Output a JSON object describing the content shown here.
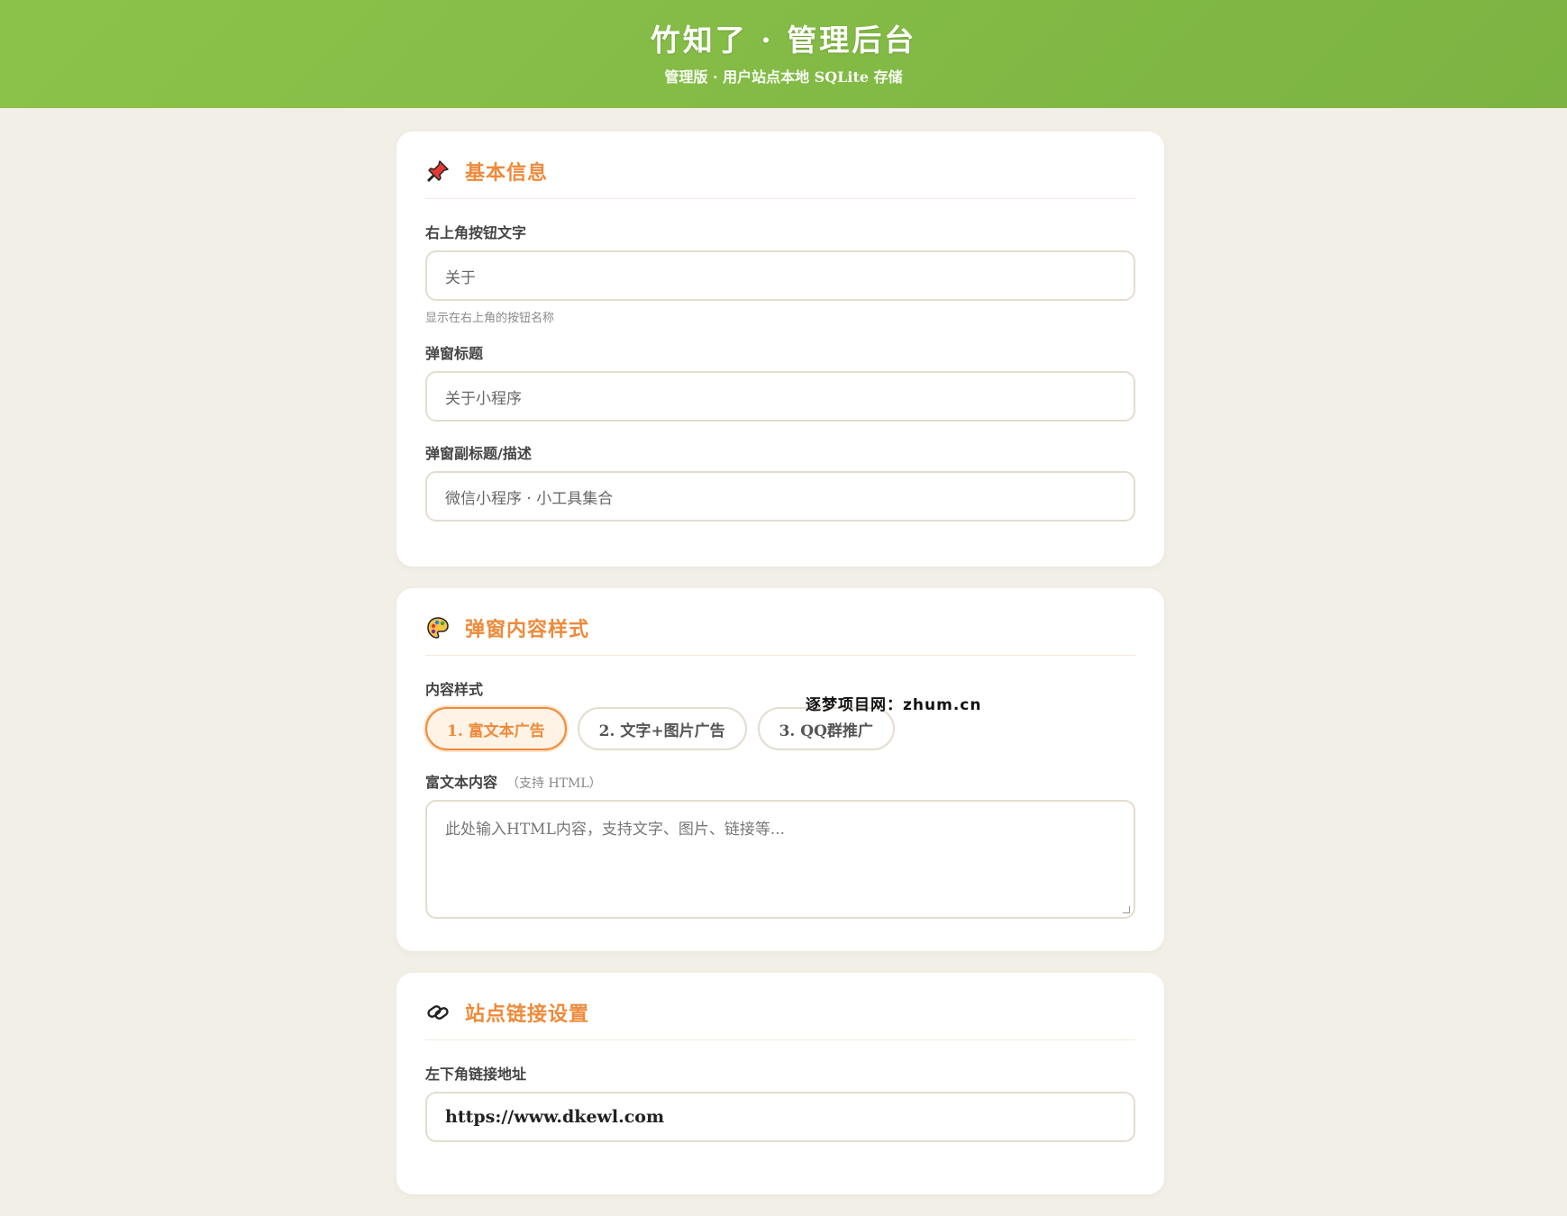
{
  "header": {
    "title": "竹知了 · 管理后台",
    "subtitle": "管理版 · 用户站点本地 SQLite 存储"
  },
  "basic": {
    "title": "基本信息",
    "icon": "pushpin-icon",
    "button_text_label": "右上角按钮文字",
    "button_text_value": "关于",
    "button_text_help": "显示在右上角的按钮名称",
    "popup_title_label": "弹窗标题",
    "popup_title_value": "关于小程序",
    "popup_subtitle_label": "弹窗副标题/描述",
    "popup_subtitle_value": "微信小程序 · 小工具集合"
  },
  "style": {
    "title": "弹窗内容样式",
    "icon": "palette-icon",
    "content_style_label": "内容样式",
    "options": [
      "1. 富文本广告",
      "2. 文字+图片广告",
      "3. QQ群推广"
    ],
    "selected": "1. 富文本广告",
    "richtext_label": "富文本内容",
    "richtext_hint": "（支持 HTML）",
    "richtext_placeholder": "此处输入HTML内容，支持文字、图片、链接等..."
  },
  "links": {
    "title": "站点链接设置",
    "icon": "link-icon",
    "bottom_left_label": "左下角链接地址",
    "bottom_left_value": "https://www.dkewl.com"
  },
  "watermark": "逐梦项目网：zhum.cn",
  "colors": {
    "header_green": "#8bc34a",
    "accent_orange": "#ee8a3a",
    "page_bg": "#f2efe6"
  }
}
